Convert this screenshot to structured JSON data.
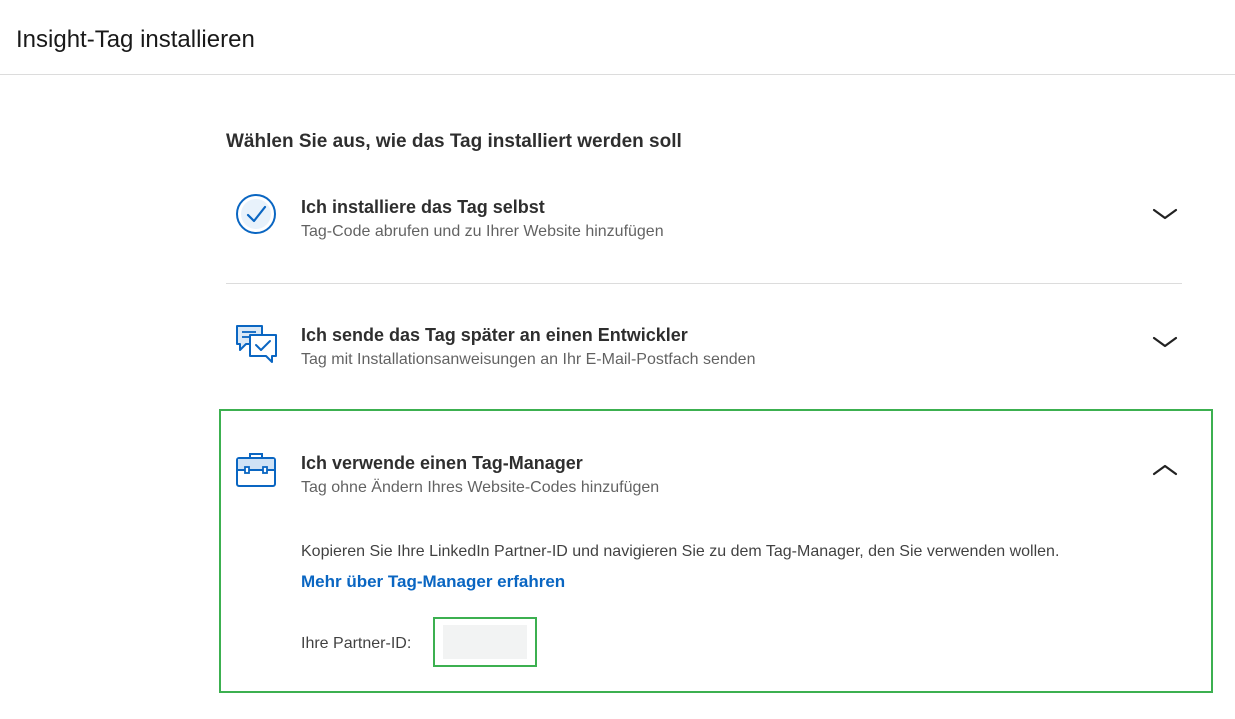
{
  "header": {
    "title": "Insight-Tag installieren"
  },
  "main": {
    "heading": "Wählen Sie aus, wie das Tag installiert werden soll",
    "options": [
      {
        "title": "Ich installiere das Tag selbst",
        "subtitle": "Tag-Code abrufen und zu Ihrer Website hinzufügen",
        "icon": "check-circle-icon",
        "expanded": false
      },
      {
        "title": "Ich sende das Tag später an einen Entwickler",
        "subtitle": "Tag mit Installationsanweisungen an Ihr E-Mail-Postfach senden",
        "icon": "chat-check-icon",
        "expanded": false
      },
      {
        "title": "Ich verwende einen Tag-Manager",
        "subtitle": "Tag ohne Ändern Ihres Website-Codes hinzufügen",
        "icon": "briefcase-icon",
        "expanded": true,
        "description": "Kopieren Sie Ihre LinkedIn Partner-ID und navigieren Sie zu dem Tag-Manager, den Sie verwenden wollen.",
        "link_label": "Mehr über Tag-Manager erfahren",
        "partner_id_label": "Ihre Partner-ID:",
        "partner_id_value": ""
      }
    ]
  },
  "colors": {
    "accent_blue": "#0a66c2",
    "icon_blue": "#0a66c2",
    "highlight_green": "#3cb050",
    "divider": "#dcdcdc"
  }
}
